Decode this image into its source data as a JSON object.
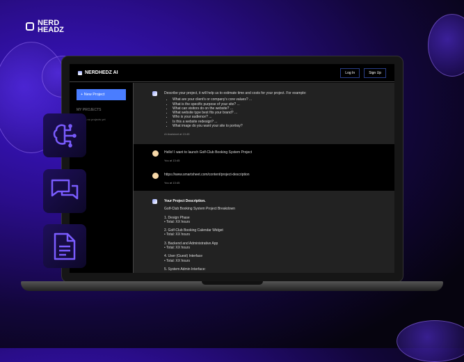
{
  "brand_logo": "NERD HEADZ",
  "app": {
    "title": "NERDHEDZ AI",
    "login": "Log In",
    "signup": "Sign Up"
  },
  "sidebar": {
    "new_project": "+ New Project",
    "section": "MY PROJECTS",
    "empty": "There is no projects yet"
  },
  "messages": [
    {
      "intro": "Describe your project, it will help us to estimate time and costs for your project. For example:",
      "items": [
        "What are your client's or company's core values? ...",
        "What is the specific purpose of your site? ...",
        "What can visitors do on the website? ...",
        "What website type best fits your brand? ...",
        "Who is your audience? ...",
        "Is this a website redesign? ...",
        "What image do you want your site to portray?"
      ],
      "meta": "AI Assistant at 13:45"
    },
    {
      "text": "Hello! I want to launch Golf-Club Booking System Project",
      "meta": "You at 13:45"
    },
    {
      "link": "https://www.smartsheet.com/content/project-description",
      "meta": "You at 13:45"
    },
    {
      "title": "Your Project Description.",
      "subtitle": "Golf-Club Booking System Project Breakdown",
      "phases": [
        {
          "name": "1. Design Phase",
          "total": "• Total: XX hours"
        },
        {
          "name": "2. Golf-Club Booking Calendar Widget",
          "total": "• Total: XX hours"
        },
        {
          "name": "3. Backend and Administrative App",
          "total": "• Total: XX hours"
        },
        {
          "name": "4. User (Guest) Interface",
          "total": "• Total: XX hours"
        },
        {
          "name": "5. System Admin Interface:",
          "total": ""
        }
      ]
    }
  ]
}
